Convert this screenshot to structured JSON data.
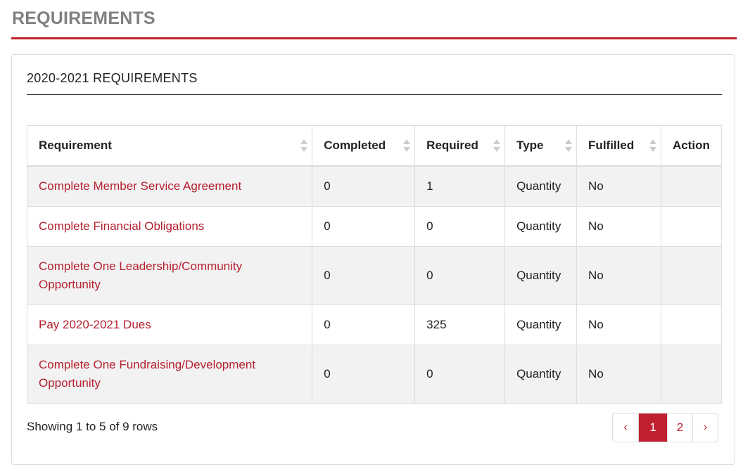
{
  "page": {
    "title": "REQUIREMENTS"
  },
  "section": {
    "title": "2020-2021 REQUIREMENTS"
  },
  "table": {
    "columns": [
      "Requirement",
      "Completed",
      "Required",
      "Type",
      "Fulfilled",
      "Action"
    ],
    "rows": [
      {
        "requirement": "Complete Member Service Agreement",
        "completed": "0",
        "required": "1",
        "type": "Quantity",
        "fulfilled": "No",
        "action": ""
      },
      {
        "requirement": "Complete Financial Obligations",
        "completed": "0",
        "required": "0",
        "type": "Quantity",
        "fulfilled": "No",
        "action": ""
      },
      {
        "requirement": "Complete One Leadership/Community Opportunity",
        "completed": "0",
        "required": "0",
        "type": "Quantity",
        "fulfilled": "No",
        "action": ""
      },
      {
        "requirement": "Pay 2020-2021 Dues",
        "completed": "0",
        "required": "325",
        "type": "Quantity",
        "fulfilled": "No",
        "action": ""
      },
      {
        "requirement": "Complete One Fundraising/Development Opportunity",
        "completed": "0",
        "required": "0",
        "type": "Quantity",
        "fulfilled": "No",
        "action": ""
      }
    ]
  },
  "footer": {
    "showing": "Showing 1 to 5 of 9 rows"
  },
  "pagination": {
    "prev": "‹",
    "pages": [
      "1",
      "2"
    ],
    "current": "1",
    "next": "›"
  },
  "colors": {
    "accent": "#c0202f",
    "title_gray": "#808080",
    "row_stripe": "#f2f2f2"
  },
  "icons": {
    "sort": "sort-both-icon",
    "prev": "chevron-left-icon",
    "next": "chevron-right-icon"
  }
}
